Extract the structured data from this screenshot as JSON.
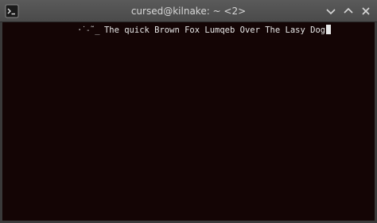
{
  "window": {
    "title": "cursed@kilnake: ~ <2>"
  },
  "icons": {
    "app": "terminal-app-icon",
    "minimize": "chevron-down-icon",
    "maximize": "chevron-up-icon",
    "close": "close-icon"
  },
  "colors": {
    "titlebar": "#4f4f4f",
    "terminal_bg": "#140505",
    "text": "#e6e6e6"
  },
  "terminal": {
    "prompt_glyph": "·˙˗˜̲",
    "output_text": "The quick Brown Fox Lumqeb Over The Lasy Dog"
  }
}
